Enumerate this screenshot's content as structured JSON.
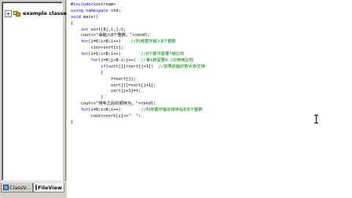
{
  "workspace": {
    "tree": {
      "expander": "+",
      "root_label": "example classes"
    },
    "tabs": [
      {
        "label": "ClassV...",
        "icon": "class-view-icon"
      },
      {
        "label": "FileView",
        "icon": "file-view-icon"
      }
    ]
  },
  "editor": {
    "lines": [
      {
        "indent": "",
        "parts": [
          [
            "kw",
            "#include"
          ],
          [
            "",
            "<iostream>"
          ]
        ]
      },
      {
        "indent": "",
        "parts": [
          [
            "kw",
            "using namespace"
          ],
          [
            "",
            " std;"
          ]
        ]
      },
      {
        "indent": "",
        "parts": [
          [
            "kw",
            "void"
          ],
          [
            "",
            " main()"
          ]
        ]
      },
      {
        "indent": "",
        "parts": [
          [
            "",
            "{"
          ]
        ]
      },
      {
        "indent": "    ",
        "parts": [
          [
            "kw",
            "int"
          ],
          [
            "",
            " sort[8],i,j,t;"
          ]
        ]
      },
      {
        "indent": "    ",
        "parts": [
          [
            "",
            "cout<<\"请输入8个整数，\"<<endl;"
          ]
        ]
      },
      {
        "indent": "    ",
        "parts": [
          [
            "kw",
            "for"
          ],
          [
            "",
            "(i=0;i<8;i++)"
          ],
          [
            "cm",
            "    //利用循环输入8个整数"
          ]
        ]
      },
      {
        "indent": "        ",
        "parts": [
          [
            "",
            "cin>>sort[i];"
          ]
        ]
      },
      {
        "indent": "    ",
        "parts": [
          [
            "kw",
            "for"
          ],
          [
            "",
            "(i=1;i<8;i++)"
          ],
          [
            "cm",
            "        //8个数共需要7趟比较"
          ]
        ]
      },
      {
        "indent": "        ",
        "parts": [
          [
            "kw",
            "for"
          ],
          [
            "",
            "(j=0;j<8-i;j++)"
          ],
          [
            "cm",
            "  //第i趟需要8-i次两两比较"
          ]
        ]
      },
      {
        "indent": "            ",
        "parts": [
          [
            "kw",
            "if"
          ],
          [
            "",
            "(sort[j]>sort[j+1])"
          ],
          [
            "cm",
            "  //如果前面的数大就交换"
          ]
        ]
      },
      {
        "indent": "            ",
        "parts": [
          [
            "",
            "{"
          ]
        ]
      },
      {
        "indent": "                ",
        "parts": [
          [
            "",
            "t=sort[j];"
          ]
        ]
      },
      {
        "indent": "                ",
        "parts": [
          [
            "",
            "sort[j]=sort[j+1];"
          ]
        ]
      },
      {
        "indent": "                ",
        "parts": [
          [
            "",
            "sort[j+1]=t;"
          ]
        ]
      },
      {
        "indent": "            ",
        "parts": [
          [
            "",
            "}"
          ]
        ]
      },
      {
        "indent": "    ",
        "parts": [
          [
            "",
            "cout<<\"排序之后的顺序为，\"<<endl;"
          ]
        ]
      },
      {
        "indent": "    ",
        "parts": [
          [
            "kw",
            "for"
          ],
          [
            "",
            "(i=0;i<8;i++)"
          ],
          [
            "cm",
            "        //利用循环输出排序后的8个整数"
          ]
        ]
      },
      {
        "indent": "        ",
        "parts": [
          [
            "",
            "cout<<sort[i]<<\"  \";"
          ]
        ]
      },
      {
        "indent": "",
        "parts": [
          [
            "",
            "}"
          ]
        ]
      }
    ]
  },
  "colors": {
    "keyword": "#0000ff",
    "comment": "#008000",
    "text": "#000000",
    "editor_bg": "#ffffff",
    "chrome": "#d4d0c8"
  },
  "cursor": "i-beam-cursor-icon"
}
